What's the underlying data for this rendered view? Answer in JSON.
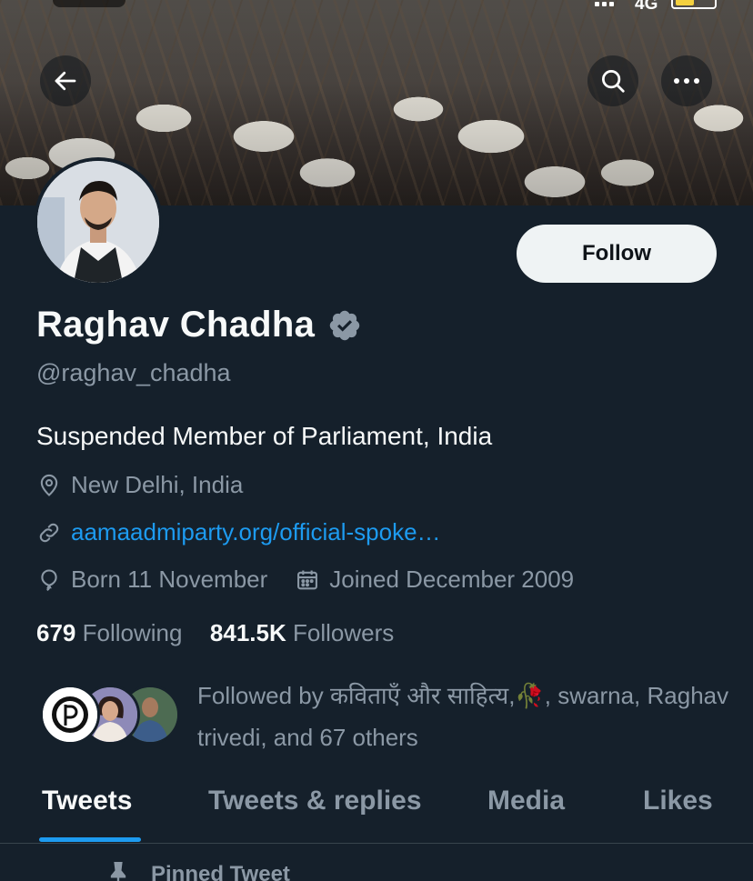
{
  "status_bar": {
    "network": "4G"
  },
  "header": {
    "back_icon": "arrow-left-icon",
    "search_icon": "search-icon",
    "more_icon": "more-horizontal-icon"
  },
  "profile": {
    "follow_label": "Follow",
    "display_name": "Raghav Chadha",
    "verified": true,
    "handle": "@raghav_chadha",
    "bio": "Suspended Member of Parliament, India",
    "location": "New Delhi, India",
    "website": "aamaadmiparty.org/official-spoke…",
    "birthday": "Born 11 November",
    "joined": "Joined December 2009",
    "following_count": "679",
    "following_label": "Following",
    "followers_count": "841.5K",
    "followers_label": "Followers",
    "followed_by": "Followed by कविताएँ और साहित्य,🥀, swarna, Raghav trivedi, and 67 others"
  },
  "tabs": [
    {
      "label": "Tweets",
      "active": true
    },
    {
      "label": "Tweets & replies",
      "active": false
    },
    {
      "label": "Media",
      "active": false
    },
    {
      "label": "Likes",
      "active": false
    }
  ],
  "pinned_label": "Pinned Tweet",
  "colors": {
    "background": "#15202b",
    "accent": "#1d9bf0",
    "secondary_text": "#8b98a5",
    "primary_text": "#f7f9f9",
    "follow_button_bg": "#eff3f4"
  }
}
